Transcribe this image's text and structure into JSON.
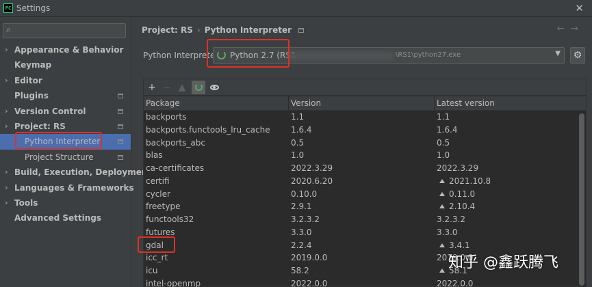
{
  "window": {
    "title": "Settings",
    "app_icon_text": "PC"
  },
  "search": {
    "placeholder": "",
    "value": ""
  },
  "sidebar": {
    "items": [
      {
        "label": "Appearance & Behavior",
        "expandable": true,
        "badge": false
      },
      {
        "label": "Keymap",
        "expandable": false,
        "badge": false
      },
      {
        "label": "Editor",
        "expandable": true,
        "badge": false
      },
      {
        "label": "Plugins",
        "expandable": false,
        "badge": true
      },
      {
        "label": "Version Control",
        "expandable": true,
        "badge": true
      },
      {
        "label": "Project: RS",
        "expandable": true,
        "badge": true
      },
      {
        "label": "Python Interpreter",
        "expandable": false,
        "badge": true,
        "selected": true,
        "child": true
      },
      {
        "label": "Project Structure",
        "expandable": false,
        "badge": true,
        "child": true
      },
      {
        "label": "Build, Execution, Deployment",
        "expandable": true,
        "badge": false
      },
      {
        "label": "Languages & Frameworks",
        "expandable": true,
        "badge": false
      },
      {
        "label": "Tools",
        "expandable": true,
        "badge": false
      },
      {
        "label": "Advanced Settings",
        "expandable": false,
        "badge": false
      }
    ]
  },
  "breadcrumb": {
    "parent": "Project: RS",
    "separator": "›",
    "current": "Python Interpreter"
  },
  "interpreter": {
    "label": "Python Interpreter:",
    "selected_name": "Python 2.7 (RS1",
    "path_suffix": "\\RS1\\python27.exe"
  },
  "packages": {
    "columns": [
      "Package",
      "Version",
      "Latest version"
    ],
    "rows": [
      {
        "name": "backports",
        "version": "1.1",
        "latest": "1.1",
        "upgrade": false
      },
      {
        "name": "backports.functools_lru_cache",
        "version": "1.6.4",
        "latest": "1.6.4",
        "upgrade": false
      },
      {
        "name": "backports_abc",
        "version": "0.5",
        "latest": "0.5",
        "upgrade": false
      },
      {
        "name": "blas",
        "version": "1.0",
        "latest": "1.0",
        "upgrade": false
      },
      {
        "name": "ca-certificates",
        "version": "2022.3.29",
        "latest": "2022.3.29",
        "upgrade": false
      },
      {
        "name": "certifi",
        "version": "2020.6.20",
        "latest": "2021.10.8",
        "upgrade": true
      },
      {
        "name": "cycler",
        "version": "0.10.0",
        "latest": "0.11.0",
        "upgrade": true
      },
      {
        "name": "freetype",
        "version": "2.9.1",
        "latest": "2.10.4",
        "upgrade": true
      },
      {
        "name": "functools32",
        "version": "3.2.3.2",
        "latest": "3.2.3.2",
        "upgrade": false
      },
      {
        "name": "futures",
        "version": "3.3.0",
        "latest": "3.3.0",
        "upgrade": false
      },
      {
        "name": "gdal",
        "version": "2.2.4",
        "latest": "3.4.1",
        "upgrade": true
      },
      {
        "name": "icc_rt",
        "version": "2019.0.0",
        "latest": "2019.0.0",
        "upgrade": false
      },
      {
        "name": "icu",
        "version": "58.2",
        "latest": "58.1",
        "upgrade": true
      },
      {
        "name": "intel-openmp",
        "version": "2022.0.0",
        "latest": "2022.0.0",
        "upgrade": false
      }
    ]
  },
  "watermark": "知乎 @鑫跃腾飞",
  "colors": {
    "background": "#3c3f41",
    "table_bg": "#2b2b2b",
    "selection": "#4b6eaf",
    "highlight": "#e0302a",
    "accent_green": "#59a869"
  }
}
